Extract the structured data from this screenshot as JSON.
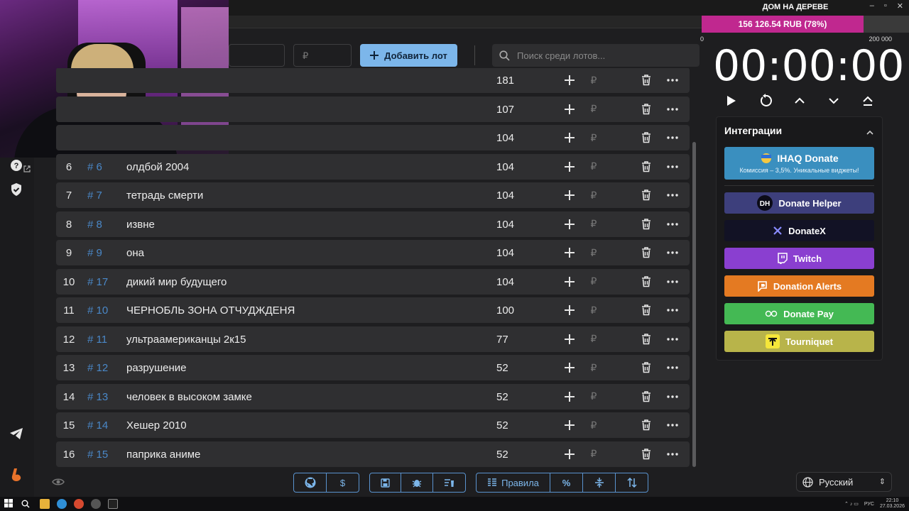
{
  "window": {
    "title": "ДОМ НА ДЕРЕВЕ"
  },
  "progress": {
    "text": "156 126.54 RUB (78%)",
    "fraction": 0.78,
    "min": "0",
    "max": "200 000",
    "color": "#c0288f"
  },
  "inputs": {
    "amount_placeholder": "₽"
  },
  "add_button": {
    "label": "Добавить лот"
  },
  "search": {
    "placeholder": "Поиск среди лотов..."
  },
  "lots": [
    {
      "num": "",
      "id": "",
      "name": "",
      "amount": "181"
    },
    {
      "num": "",
      "id": "",
      "name": "",
      "amount": "107"
    },
    {
      "num": "",
      "id": "",
      "name": "",
      "amount": "104"
    },
    {
      "num": "6",
      "id": "# 6",
      "name": "олдбой 2004",
      "amount": "104"
    },
    {
      "num": "7",
      "id": "# 7",
      "name": "тетрадь смерти",
      "amount": "104"
    },
    {
      "num": "8",
      "id": "# 8",
      "name": "извне",
      "amount": "104"
    },
    {
      "num": "9",
      "id": "# 9",
      "name": "она",
      "amount": "104"
    },
    {
      "num": "10",
      "id": "# 17",
      "name": "дикий мир будущего",
      "amount": "104"
    },
    {
      "num": "11",
      "id": "# 10",
      "name": "ЧЕРНОБЛЬ ЗОНА ОТЧУДЖДЕНЯ",
      "amount": "100"
    },
    {
      "num": "12",
      "id": "# 11",
      "name": "ультраамериканцы 2к15",
      "amount": "77"
    },
    {
      "num": "13",
      "id": "# 12",
      "name": "разрушение",
      "amount": "52"
    },
    {
      "num": "14",
      "id": "# 13",
      "name": "человек в высоком замке",
      "amount": "52"
    },
    {
      "num": "15",
      "id": "# 14",
      "name": "Хешер 2010",
      "amount": "52"
    },
    {
      "num": "16",
      "id": "# 15",
      "name": "паприка аниме",
      "amount": "52"
    }
  ],
  "row_icons": {
    "add": "plus-icon",
    "currency": "₽",
    "delete": "trash-icon",
    "more": "more-icon"
  },
  "toolbar": {
    "rules_label": "Правила"
  },
  "timer": {
    "value": "00:00:00"
  },
  "integrations": {
    "title": "Интеграции",
    "ihaq": {
      "label": "IHAQ Donate",
      "subtitle": "Комиссия – 3,5%. Уникальные виджеты!",
      "color": "#3a8fbf"
    },
    "items": [
      {
        "label": "Donate Helper",
        "color": "#3d3f7c"
      },
      {
        "label": "DonateX",
        "color": "#121225"
      },
      {
        "label": "Twitch",
        "color": "#8a3fd0"
      },
      {
        "label": "Donation Alerts",
        "color": "#e47a22"
      },
      {
        "label": "Donate Pay",
        "color": "#44b954"
      },
      {
        "label": "Tourniquet",
        "color": "#b8b44a"
      }
    ]
  },
  "language": {
    "label": "Русский"
  },
  "taskbar": {
    "lang": "РУС",
    "time": "22:10",
    "date": "27.03.2026"
  }
}
